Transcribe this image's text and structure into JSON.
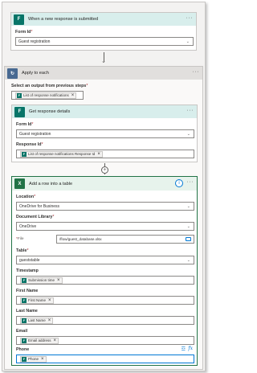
{
  "trigger": {
    "title": "When a new response is submitted",
    "icon": "forms-icon",
    "form_id_label": "Form Id",
    "form_id_value": "Guest registration"
  },
  "apply_each": {
    "title": "Apply to each",
    "icon": "loop-icon",
    "select_label": "Select an output from previous steps",
    "select_token": "List of response notifications"
  },
  "get_response": {
    "title": "Get response details",
    "form_id_label": "Form Id",
    "form_id_value": "Guest registration",
    "response_id_label": "Response Id",
    "response_id_token": "List of response notifications Response Id"
  },
  "add_row": {
    "title": "Add a row into a table",
    "icon": "excel-icon",
    "location_label": "Location",
    "location_value": "OneDrive for Business",
    "library_label": "Document Library",
    "library_value": "OneDrive",
    "file_label": "File",
    "file_value": "/flow/guest_database.xlsx",
    "table_label": "Table",
    "table_value": "gueststable",
    "fields": [
      {
        "label": "Timestamp",
        "token": "Submission time"
      },
      {
        "label": "First Name",
        "token": "First Name"
      },
      {
        "label": "Last Name",
        "token": "Last Name"
      },
      {
        "label": "Email",
        "token": "Email address"
      },
      {
        "label": "Phone",
        "token": "Phone"
      }
    ]
  },
  "colors": {
    "forms_teal": "#077568",
    "excel_green": "#217346",
    "selected_border": "#217346",
    "required": "#a4262c"
  }
}
